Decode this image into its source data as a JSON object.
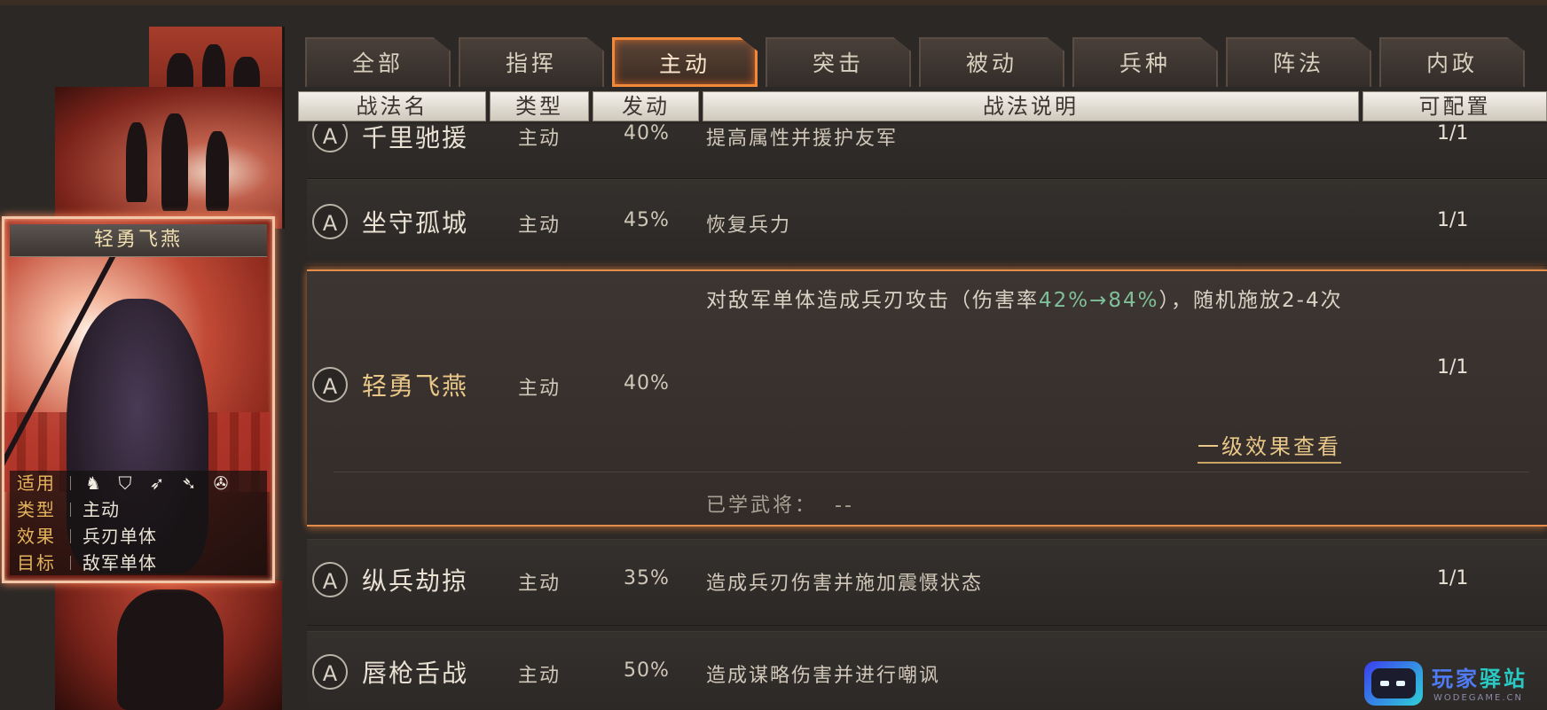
{
  "tabs": [
    {
      "label": "全部"
    },
    {
      "label": "指挥"
    },
    {
      "label": "主动"
    },
    {
      "label": "突击"
    },
    {
      "label": "被动"
    },
    {
      "label": "兵种"
    },
    {
      "label": "阵法"
    },
    {
      "label": "内政"
    }
  ],
  "active_tab": "主动",
  "columns": {
    "name": "战法名",
    "type": "类型",
    "rate": "发动",
    "desc": "战法说明",
    "config": "可配置"
  },
  "selected_card": {
    "title": "轻勇飞燕",
    "apply_label": "适用",
    "troop_icons": [
      "cavalry-icon",
      "shield-icon",
      "bow-icon",
      "spear-icon",
      "wheel-icon"
    ],
    "type_label": "类型",
    "type_value": "主动",
    "effect_label": "效果",
    "effect_value": "兵刃单体",
    "target_label": "目标",
    "target_value": "敌军单体"
  },
  "rows": [
    {
      "grade": "A",
      "name": "千里驰援",
      "type": "主动",
      "rate": "40%",
      "desc": "提高属性并援护友军",
      "config": "1/1"
    },
    {
      "grade": "A",
      "name": "坐守孤城",
      "type": "主动",
      "rate": "45%",
      "desc": "恢复兵力",
      "config": "1/1"
    },
    {
      "grade": "A",
      "name": "轻勇飞燕",
      "type": "主动",
      "rate": "40%",
      "desc_part1": "对敌军单体造成兵刃攻击（伤害率",
      "desc_green": "42%→84%",
      "desc_part2": "），随机施放2-4次",
      "config": "1/1",
      "effect_link": "一级效果查看",
      "learned_label": "已学武将：",
      "learned_value": "--"
    },
    {
      "grade": "A",
      "name": "纵兵劫掠",
      "type": "主动",
      "rate": "35%",
      "desc": "造成兵刃伤害并施加震慑状态",
      "config": "1/1"
    },
    {
      "grade": "A",
      "name": "唇枪舌战",
      "type": "主动",
      "rate": "50%",
      "desc": "造成谋略伤害并进行嘲讽",
      "config": ""
    }
  ],
  "watermark": {
    "text1": "玩家",
    "text2": "驿站",
    "sub": "WODEGAME.CN"
  },
  "colors": {
    "active_tab_border": "#f08a3a",
    "highlight_green": "#7fc09a",
    "gold_text": "#e9c789"
  }
}
